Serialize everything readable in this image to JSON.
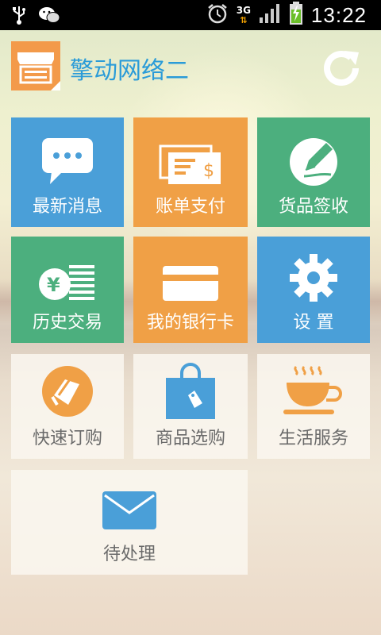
{
  "status_bar": {
    "time": "13:22",
    "network": "3G",
    "icons": [
      "usb-icon",
      "wechat-icon",
      "alarm-icon",
      "signal-icon",
      "battery-charging-icon"
    ]
  },
  "header": {
    "title": "擎动网络二",
    "logo_icon": "store-icon",
    "refresh_icon": "refresh-icon"
  },
  "tiles": [
    {
      "label": "最新消息",
      "icon": "message-icon",
      "color": "#4a9fd8"
    },
    {
      "label": "账单支付",
      "icon": "bill-icon",
      "color": "#f0a046"
    },
    {
      "label": "货品签收",
      "icon": "sign-icon",
      "color": "#4caf7e"
    },
    {
      "label": "历史交易",
      "icon": "history-icon",
      "color": "#4caf7e"
    },
    {
      "label": "我的银行卡",
      "icon": "bank-card-icon",
      "color": "#f0a046"
    },
    {
      "label": "设 置",
      "icon": "gear-icon",
      "color": "#4a9fd8"
    },
    {
      "label": "快速订购",
      "icon": "quick-order-icon",
      "color": "#f0a046"
    },
    {
      "label": "商品选购",
      "icon": "shopping-bag-icon",
      "color": "#4a9fd8"
    },
    {
      "label": "生活服务",
      "icon": "coffee-cup-icon",
      "color": "#f0a046"
    },
    {
      "label": "待处理",
      "icon": "mail-icon",
      "color": "#4a9fd8"
    }
  ]
}
